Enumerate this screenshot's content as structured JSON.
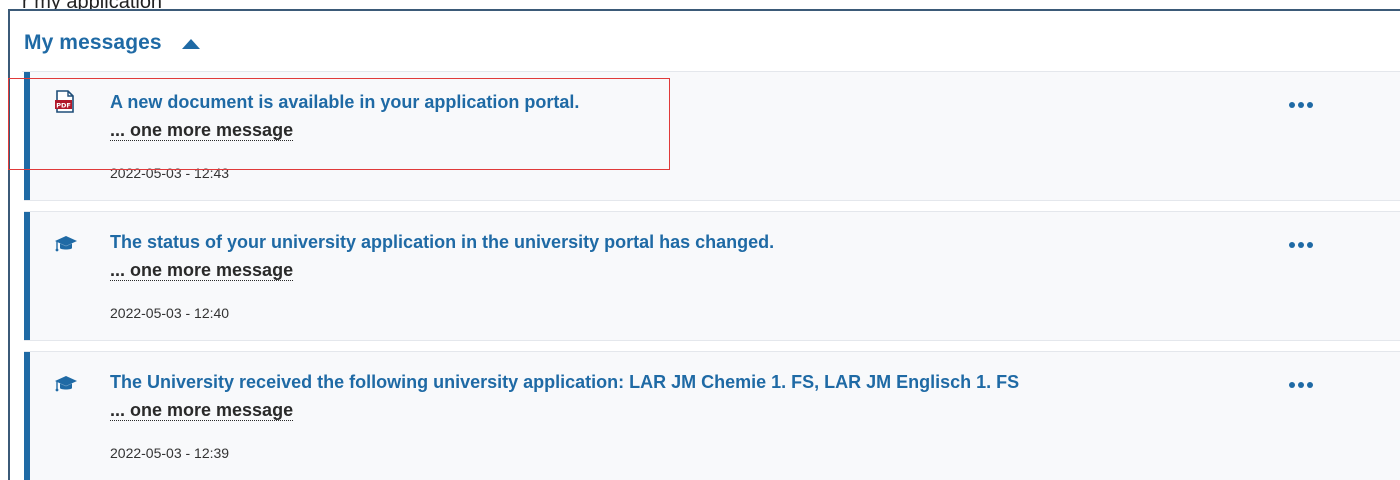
{
  "page": {
    "top_fragment": "r my application"
  },
  "panel": {
    "title": "My messages",
    "collapse_icon": "chevron-up-icon",
    "accent_color": "#1f6aa5"
  },
  "messages": [
    {
      "icon": "pdf-document-icon",
      "title": "A new document is available in your application portal.",
      "more_link": "... one more message",
      "timestamp": "2022-05-03 - 12:43",
      "menu_icon": "more-options-icon"
    },
    {
      "icon": "graduation-cap-icon",
      "title": "The status of your university application in the university portal has changed.",
      "more_link": "... one more message",
      "timestamp": "2022-05-03 - 12:40",
      "menu_icon": "more-options-icon"
    },
    {
      "icon": "graduation-cap-icon",
      "title": "The University received the following university application: LAR JM Chemie 1. FS, LAR JM Englisch 1. FS",
      "more_link": "... one more message",
      "timestamp": "2022-05-03 - 12:39",
      "menu_icon": "more-options-icon"
    }
  ]
}
